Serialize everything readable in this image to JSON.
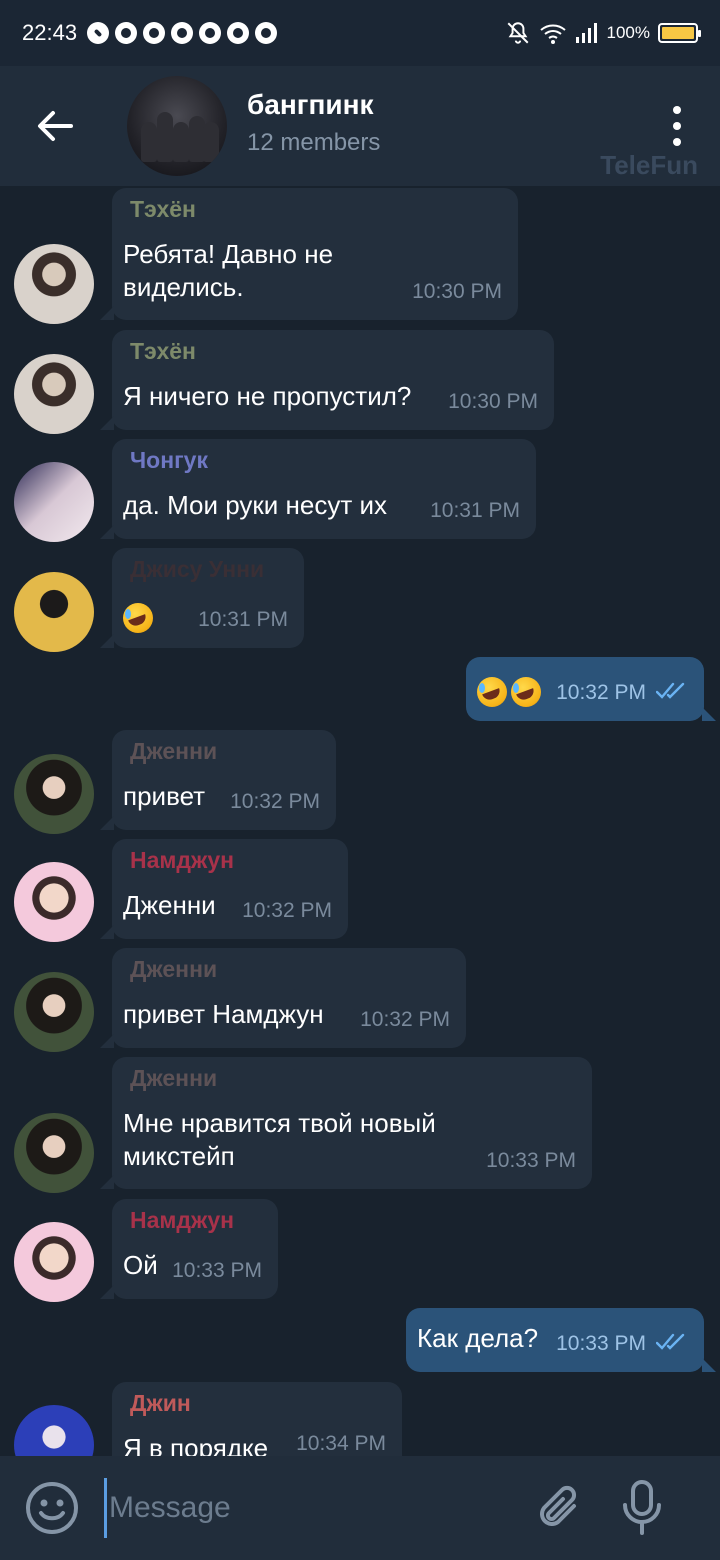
{
  "status_bar": {
    "time": "22:43",
    "battery": "100%",
    "notification_icons": [
      "messenger-icon",
      "chrome-icon",
      "chrome-icon",
      "chrome-icon",
      "chrome-icon",
      "chrome-icon",
      "chrome-icon"
    ],
    "battery_level": 1.0
  },
  "header": {
    "title": "бангпинк",
    "subtitle": "12 members",
    "watermark": "TeleFun"
  },
  "messages": [
    {
      "sender": "Тэхён",
      "sender_color": "#7d8a6a",
      "text_lines": [
        "Ребята! Давно не",
        "виделись."
      ],
      "time": "10:30 PM"
    },
    {
      "sender": "Тэхён",
      "sender_color": "#7d8a6a",
      "text_lines": [
        "Я ничего не пропустил?"
      ],
      "time": "10:30 PM"
    },
    {
      "sender": "Чонгук",
      "sender_color": "#6f78c4",
      "text_lines": [
        "да.  Мои руки несут их"
      ],
      "time": "10:31 PM"
    },
    {
      "sender": "Джису Унни",
      "sender_color": "#3a2f35",
      "text_lines": [],
      "emoji_count": 1,
      "time": "10:31 PM"
    },
    {
      "outgoing": true,
      "emoji_count": 2,
      "time": "10:32 PM"
    },
    {
      "sender": "Дженни",
      "sender_color": "#5d5256",
      "text_lines": [
        "привет"
      ],
      "time": "10:32 PM"
    },
    {
      "sender": "Намджун",
      "sender_color": "#a8324a",
      "text_lines": [
        "Дженни"
      ],
      "time": "10:32 PM"
    },
    {
      "sender": "Дженни",
      "sender_color": "#5d5256",
      "text_lines": [
        "привет Намджун"
      ],
      "time": "10:32 PM"
    },
    {
      "sender": "Дженни",
      "sender_color": "#5d5256",
      "text_lines": [
        "Мне нравится твой новый",
        "микстейп"
      ],
      "time": "10:33 PM"
    },
    {
      "sender": "Намджун",
      "sender_color": "#a8324a",
      "text_lines": [
        "Ой"
      ],
      "time": "10:33 PM"
    },
    {
      "outgoing": true,
      "text_lines": [
        "Как дела?"
      ],
      "time": "10:33 PM"
    },
    {
      "sender": "Джин",
      "sender_color": "#c05a5a",
      "text_lines": [
        "Я в порядке"
      ],
      "time": "10:34 PM"
    }
  ],
  "input": {
    "placeholder": "Message"
  },
  "colors": {
    "background": "#18222d",
    "header": "#212d3b",
    "incoming_bubble": "#232f3d",
    "outgoing_bubble": "#2b5379",
    "accent": "#5b9de2"
  }
}
